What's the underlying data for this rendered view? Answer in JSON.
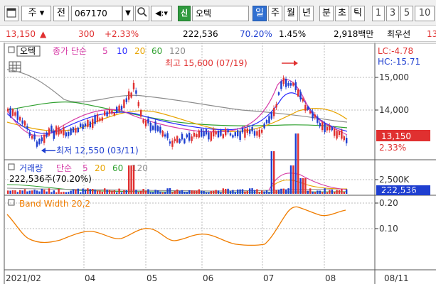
{
  "toolbar": {
    "type_label": "주",
    "chart_label": "전",
    "code_value": "067170",
    "sin_label": "신",
    "stock_name": "오텍",
    "periods": [
      "일",
      "주",
      "월",
      "년",
      "분",
      "초",
      "틱"
    ],
    "intervals": [
      "1",
      "3",
      "5",
      "10"
    ]
  },
  "quote": {
    "price": "13,150",
    "change_arrow": "▲",
    "change": "300",
    "change_pct": "+2.33%",
    "volume": "222,536",
    "vol_ratio": "70.20%",
    "turnover": "1.45%",
    "amount": "2,918백만",
    "broker": "최우선",
    "trail": "13"
  },
  "price_panel": {
    "stock_tag": "오텍",
    "ma_label": "종가 단순",
    "ma_periods": [
      "5",
      "10",
      "20",
      "60",
      "120"
    ],
    "lc_label": "LC:-4.78",
    "hc_label": "HC:-15.71",
    "high_annotation": "최고 15,600 (07/19)",
    "low_annotation": "최저 12,550 (03/11)",
    "current_price": "13,150",
    "current_pct": "2.33%",
    "y_ticks": [
      "15,000",
      "14,000"
    ]
  },
  "volume_panel": {
    "title": "거래량",
    "ma_label": "단순",
    "ma_periods": [
      "5",
      "20",
      "60",
      "120"
    ],
    "info": "222,536주(70.20%)",
    "y_tick": "2,500K",
    "current_volume": "222,536",
    "current_pct": "70.20%"
  },
  "band_panel": {
    "title": "Band Width 20,2",
    "y_ticks": [
      "0.20",
      "0.10"
    ]
  },
  "x_axis": {
    "labels": [
      "2021/02",
      "04",
      "05",
      "06",
      "07",
      "08"
    ],
    "end_label": "08/11"
  },
  "colors": {
    "up": "#e03030",
    "down": "#1f3fd0",
    "ma5": "#d63aa6",
    "ma10": "#2c2cff",
    "ma20": "#e8a400",
    "ma60": "#2fa02f",
    "ma120": "#8c8c8c",
    "band": "#f07d00",
    "price_box": "#e03030",
    "volume_box": "#1f3fd0"
  },
  "chart_data": {
    "type": "candlestick",
    "price_panel": {
      "high": 15600,
      "high_date": "07/19",
      "low": 12550,
      "low_date": "03/11",
      "last": 13150
    },
    "volume_panel": {
      "last": 222536
    }
  }
}
